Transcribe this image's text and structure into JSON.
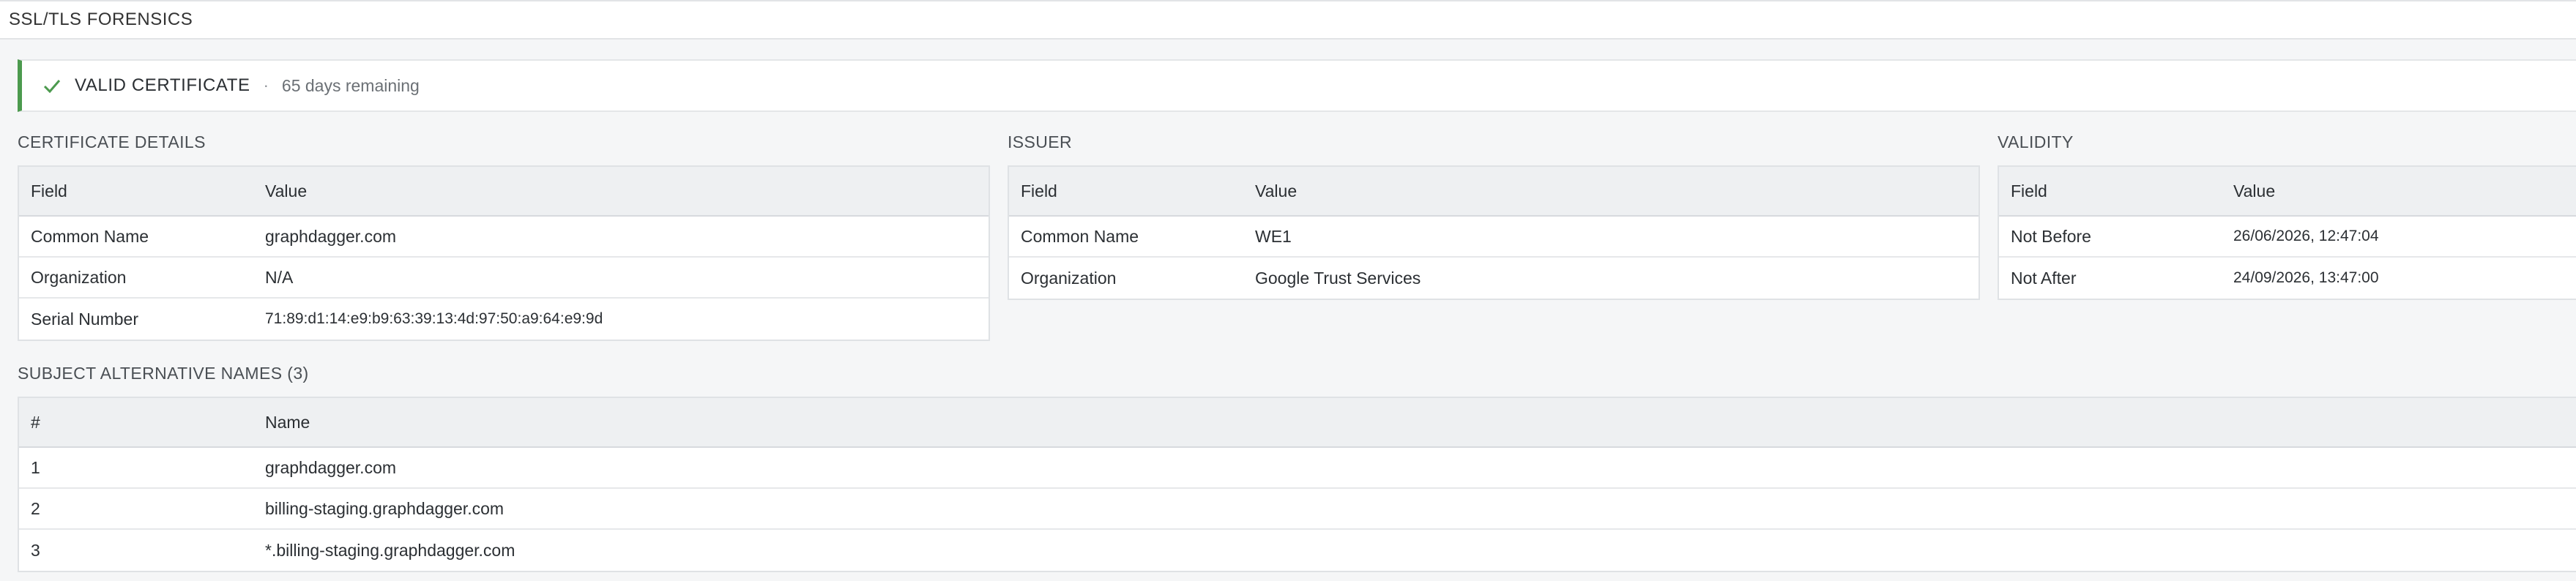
{
  "header": {
    "title": "SSL/TLS FORENSICS"
  },
  "status": {
    "label": "VALID CERTIFICATE",
    "separator": "·",
    "remaining": "65 days remaining",
    "accent_color": "#4c9a4e",
    "icon": "check-icon"
  },
  "certificate_details": {
    "title": "CERTIFICATE DETAILS",
    "columns": [
      "Field",
      "Value"
    ],
    "rows": [
      {
        "field": "Common Name",
        "value": "graphdagger.com"
      },
      {
        "field": "Organization",
        "value": "N/A"
      },
      {
        "field": "Serial Number",
        "value": "71:89:d1:14:e9:b9:63:39:13:4d:97:50:a9:64:e9:9d"
      }
    ]
  },
  "issuer": {
    "title": "ISSUER",
    "columns": [
      "Field",
      "Value"
    ],
    "rows": [
      {
        "field": "Common Name",
        "value": "WE1"
      },
      {
        "field": "Organization",
        "value": "Google Trust Services"
      }
    ]
  },
  "validity": {
    "title": "VALIDITY",
    "columns": [
      "Field",
      "Value"
    ],
    "rows": [
      {
        "field": "Not Before",
        "value": "26/06/2026, 12:47:04"
      },
      {
        "field": "Not After",
        "value": "24/09/2026, 13:47:00"
      }
    ]
  },
  "sans": {
    "title": "SUBJECT ALTERNATIVE NAMES (3)",
    "columns": [
      "#",
      "Name"
    ],
    "rows": [
      {
        "index": "1",
        "name": "graphdagger.com"
      },
      {
        "index": "2",
        "name": "billing-staging.graphdagger.com"
      },
      {
        "index": "3",
        "name": "*.billing-staging.graphdagger.com"
      }
    ]
  }
}
